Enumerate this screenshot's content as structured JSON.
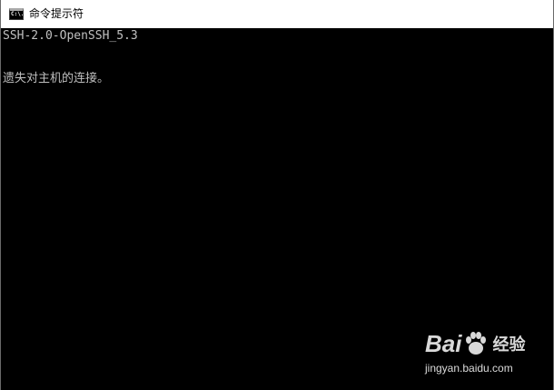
{
  "window": {
    "title": "命令提示符",
    "icon": "cmd-icon",
    "icon_label": "C:\\."
  },
  "console": {
    "lines": [
      "SSH-2.0-OpenSSH_5.3",
      "遗失对主机的连接。"
    ],
    "background": "#000000",
    "text_color": "#c0c0c0"
  },
  "watermark": {
    "brand_left": "Bai",
    "brand_right": "经验",
    "domain": "jingyan.baidu.com"
  }
}
